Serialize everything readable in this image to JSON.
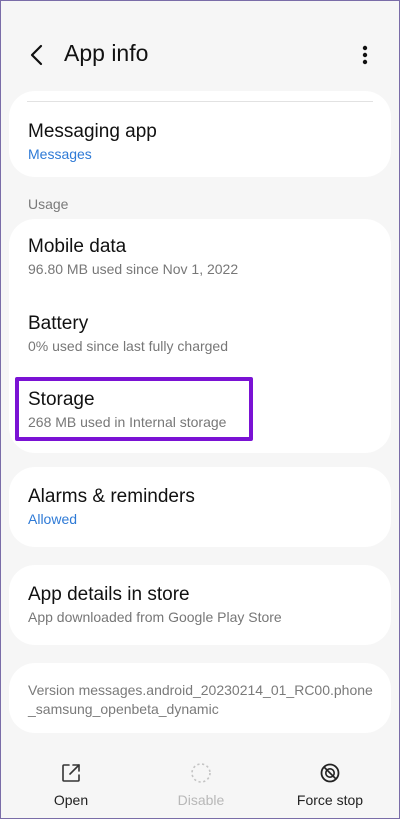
{
  "header": {
    "title": "App info",
    "back_icon": "back-arrow-icon",
    "menu_icon": "more-vert-icon"
  },
  "default_app": {
    "label": "Messaging app",
    "value": "Messages"
  },
  "usage": {
    "section_title": "Usage",
    "items": [
      {
        "label": "Mobile data",
        "sub": "96.80 MB used since Nov 1, 2022"
      },
      {
        "label": "Battery",
        "sub": "0% used since last fully charged"
      },
      {
        "label": "Storage",
        "sub": "268 MB used in Internal storage"
      }
    ]
  },
  "alarms": {
    "label": "Alarms & reminders",
    "value": "Allowed"
  },
  "store": {
    "label": "App details in store",
    "sub": "App downloaded from Google Play Store"
  },
  "version": {
    "text": "Version messages.android_20230214_01_RC00.phone_samsung_openbeta_dynamic"
  },
  "bottom_actions": {
    "open": "Open",
    "disable": "Disable",
    "force_stop": "Force stop"
  },
  "colors": {
    "accent": "#2e7ad6",
    "highlight": "#7a12d4",
    "background": "#f6f6f6",
    "card": "#ffffff"
  }
}
